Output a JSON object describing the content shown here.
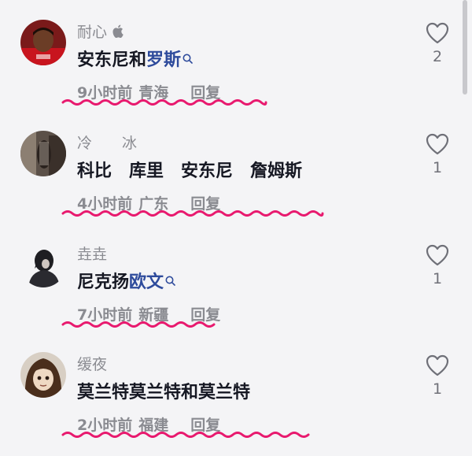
{
  "comments": [
    {
      "username": "耐心",
      "text_plain": "安东尼和",
      "text_keyword": "罗斯",
      "time": "9小时前",
      "region": "青海",
      "reply": "回复",
      "likes": "2",
      "device_icon": "apple-icon"
    },
    {
      "username": "冷　　冰",
      "text_plain": "科比　库里　安东尼　詹姆斯",
      "time": "4小时前",
      "region": "广东",
      "reply": "回复",
      "likes": "1"
    },
    {
      "username": "垚垚",
      "text_plain": "尼克扬",
      "text_keyword": "欧文",
      "time": "7小时前",
      "region": "新疆",
      "reply": "回复",
      "likes": "1"
    },
    {
      "username": "缓夜",
      "text_plain": "莫兰特莫兰特和莫兰特",
      "time": "2小时前",
      "region": "福建",
      "reply": "回复",
      "likes": "1"
    }
  ],
  "colors": {
    "keyword": "#2e4b9c",
    "squiggle": "#e8196e",
    "muted": "#8a8b91",
    "text": "#161823"
  },
  "icons": [
    "heart-icon",
    "search-icon",
    "apple-icon"
  ]
}
